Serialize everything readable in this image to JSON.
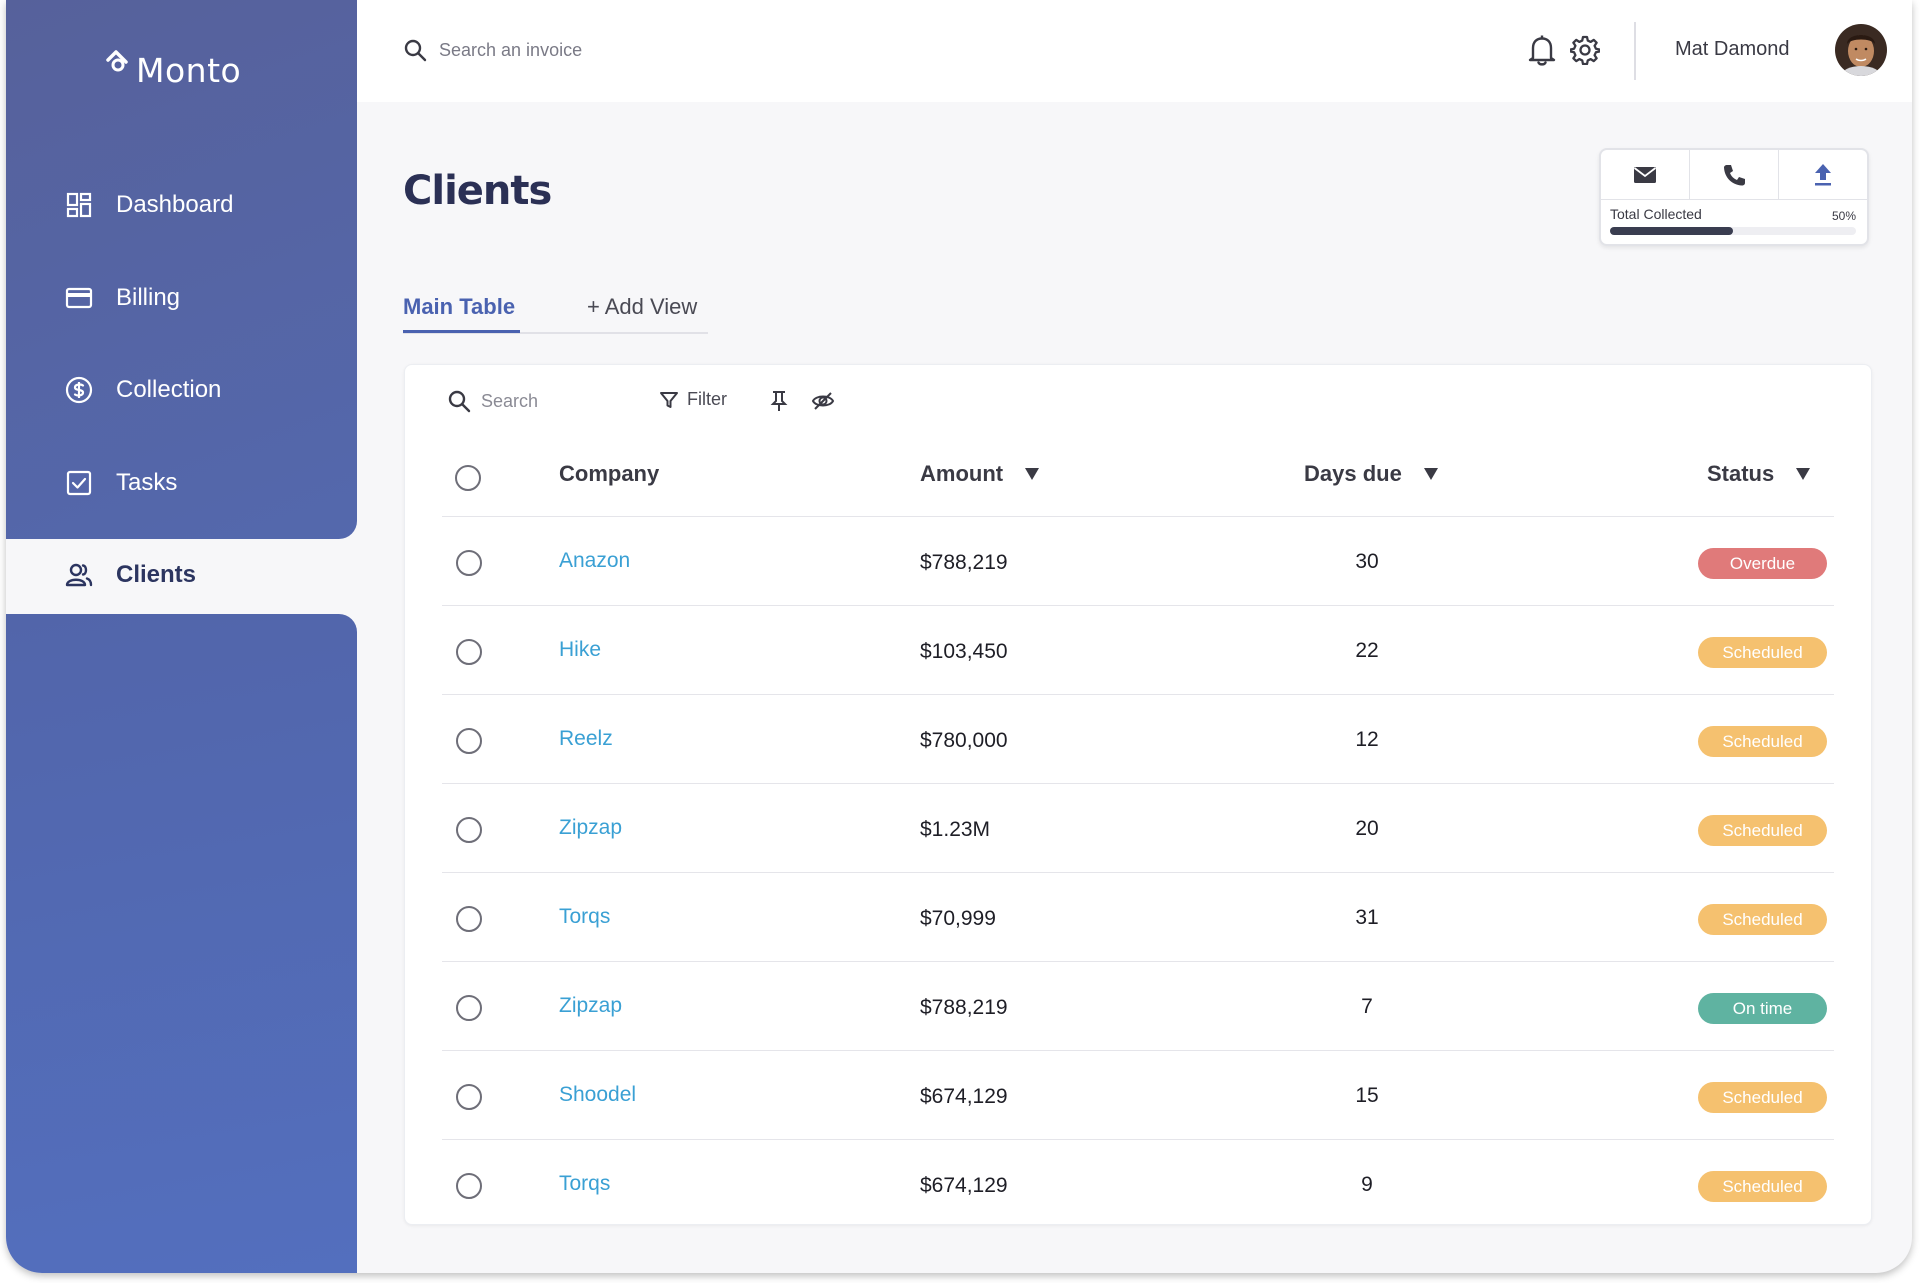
{
  "brand": {
    "name": "Monto"
  },
  "sidebar": {
    "items": [
      {
        "label": "Dashboard",
        "icon": "dashboard-icon"
      },
      {
        "label": "Billing",
        "icon": "credit-card-icon"
      },
      {
        "label": "Collection",
        "icon": "dollar-circle-icon"
      },
      {
        "label": "Tasks",
        "icon": "checkbox-icon"
      },
      {
        "label": "Clients",
        "icon": "users-icon",
        "active": true
      }
    ]
  },
  "topbar": {
    "search_placeholder": "Search an invoice",
    "user_name": "Mat Damond"
  },
  "page": {
    "title": "Clients"
  },
  "actions": {
    "buttons": [
      "mail-icon",
      "phone-icon",
      "upload-icon"
    ],
    "collected_label": "Total Collected",
    "collected_pct": "50%",
    "collected_value": 0.5
  },
  "tabs": {
    "main": "Main Table",
    "add": "+ Add View"
  },
  "table": {
    "search_placeholder": "Search",
    "filter_label": "Filter",
    "headers": {
      "company": "Company",
      "amount": "Amount",
      "days": "Days due",
      "status": "Status"
    },
    "rows": [
      {
        "company": "Anazon",
        "amount": "$788,219",
        "days": "30",
        "status": "Overdue"
      },
      {
        "company": "Hike",
        "amount": "$103,450",
        "days": "22",
        "status": "Scheduled"
      },
      {
        "company": "Reelz",
        "amount": "$780,000",
        "days": "12",
        "status": "Scheduled"
      },
      {
        "company": "Zipzap",
        "amount": "$1.23M",
        "days": "20",
        "status": "Scheduled"
      },
      {
        "company": "Torqs",
        "amount": "$70,999",
        "days": "31",
        "status": "Scheduled"
      },
      {
        "company": "Zipzap",
        "amount": "$788,219",
        "days": "7",
        "status": "On time"
      },
      {
        "company": "Shoodel",
        "amount": "$674,129",
        "days": "15",
        "status": "Scheduled"
      },
      {
        "company": "Torqs",
        "amount": "$674,129",
        "days": "9",
        "status": "Scheduled"
      }
    ]
  },
  "colors": {
    "sidebar": "#5468ad",
    "accent": "#4a62b0",
    "link": "#3aa0d4",
    "overdue": "#e07a7a",
    "scheduled": "#f5c16f",
    "on_time": "#5fb3a1"
  }
}
